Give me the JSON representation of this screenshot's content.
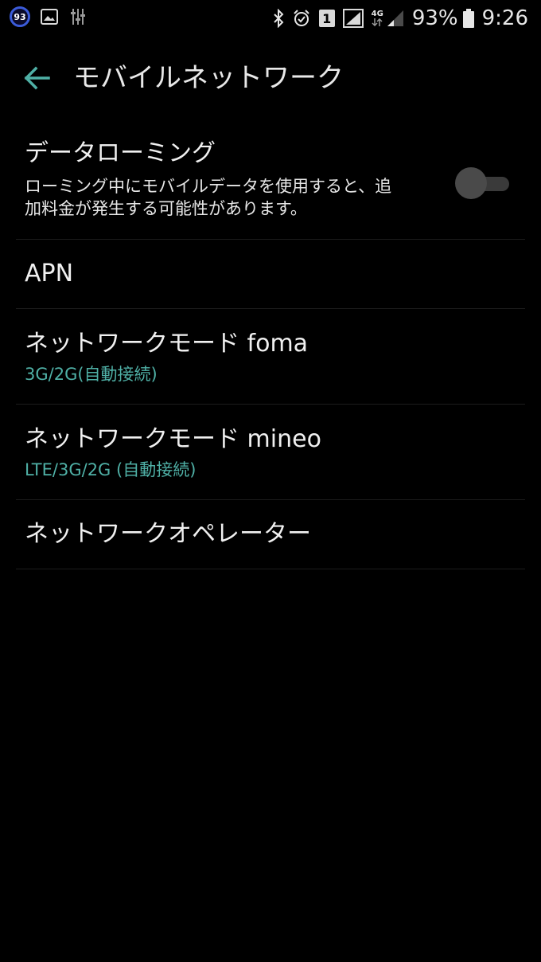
{
  "status_bar": {
    "notification_badge": "93",
    "left_icons": [
      "image-icon",
      "sliders-icon"
    ],
    "right_icons": [
      "bluetooth-icon",
      "alarm-icon",
      "sim-1-icon",
      "signal-icon",
      "data-4g-icon",
      "signal-weak-icon",
      "battery-icon"
    ],
    "sim_label": "1",
    "network_label": "4G",
    "battery_percent": "93%",
    "time": "9:26"
  },
  "app_bar": {
    "title": "モバイルネットワーク",
    "back_icon": "arrow-back-icon"
  },
  "settings": {
    "data_roaming": {
      "title": "データローミング",
      "summary_line1": "ローミング中にモバイルデータを使用すると、追",
      "summary_line2": "加料金が発生する可能性があります。",
      "enabled": false
    },
    "apn": {
      "title": "APN"
    },
    "network_mode_foma": {
      "title": "ネットワークモード foma",
      "summary": "3G/2G(自動接続)"
    },
    "network_mode_mineo": {
      "title": "ネットワークモード mineo",
      "summary": "LTE/3G/2G (自動接続)"
    },
    "network_operator": {
      "title": "ネットワークオペレーター"
    }
  },
  "colors": {
    "background": "#000000",
    "accent": "#4fb0a6",
    "text_primary": "#f0f0f0",
    "divider": "#1c1c1c"
  }
}
